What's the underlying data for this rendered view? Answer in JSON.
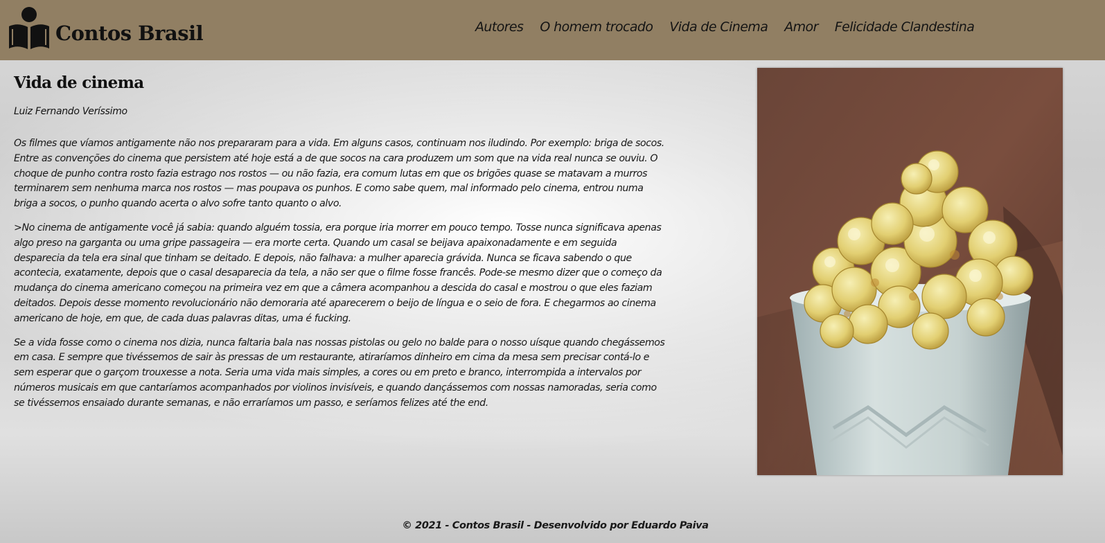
{
  "header": {
    "brand": "Contos Brasil",
    "logo_icon": "reader-book-icon",
    "background_color": "#917f63",
    "nav": [
      {
        "label": "Autores"
      },
      {
        "label": "O homem trocado"
      },
      {
        "label": "Vida de Cinema"
      },
      {
        "label": "Amor"
      },
      {
        "label": "Felicidade Clandestina"
      }
    ]
  },
  "story": {
    "title": "Vida de cinema",
    "author": "Luiz Fernando Veríssimo",
    "paragraphs": [
      "Os filmes que víamos antigamente não nos prepararam para a vida. Em alguns casos, continuam nos iludindo. Por exemplo: briga de socos. Entre as convenções do cinema que persistem até hoje está a de que socos na cara produzem um som que na vida real nunca se ouviu. O choque de punho contra rosto fazia estrago nos rostos — ou não fazia, era comum lutas em que os brigões quase se matavam a murros terminarem sem nenhuma marca nos rostos — mas poupava os punhos. E como sabe quem, mal informado pelo cinema, entrou numa briga a socos, o punho quando acerta o alvo sofre tanto quanto o alvo.",
      ">No cinema de antigamente você já sabia: quando alguém tossia, era porque iria morrer em pouco tempo. Tosse nunca significava apenas algo preso na garganta ou uma gripe passageira — era morte certa. Quando um casal se beijava apaixonadamente e em seguida desparecia da tela era sinal que tinham se deitado. E depois, não falhava: a mulher aparecia grávida. Nunca se ficava sabendo o que acontecia, exatamente, depois que o casal desaparecia da tela, a não ser que o filme fosse francês. Pode-se mesmo dizer que o começo da mudança do cinema americano começou na primeira vez em que a câmera acompanhou a descida do casal e mostrou o que eles faziam deitados. Depois desse momento revolucionário não demoraria até aparecerem o beijo de língua e o seio de fora. E chegarmos ao cinema americano de hoje, em que, de cada duas palavras ditas, uma é fucking.",
      "Se a vida fosse como o cinema nos dizia, nunca faltaria bala nas nossas pistolas ou gelo no balde para o nosso uísque quando chegássemos em casa. E sempre que tivéssemos de sair às pressas de um restaurante, atiraríamos dinheiro em cima da mesa sem precisar contá-lo e sem esperar que o garçom trouxesse a nota. Seria uma vida mais simples, a cores ou em preto e branco, interrompida a intervalos por números musicais em que cantaríamos acompanhados por violinos invisíveis, e quando dançássemos com nossas namoradas, seria como se tivéssemos ensaiado durante semanas, e não erraríamos um passo, e seríamos felizes até the end."
    ]
  },
  "image": {
    "subject": "popcorn-cup-photo"
  },
  "footer": {
    "text": "© 2021 - Contos Brasil - Desenvolvido por Eduardo Paiva"
  }
}
